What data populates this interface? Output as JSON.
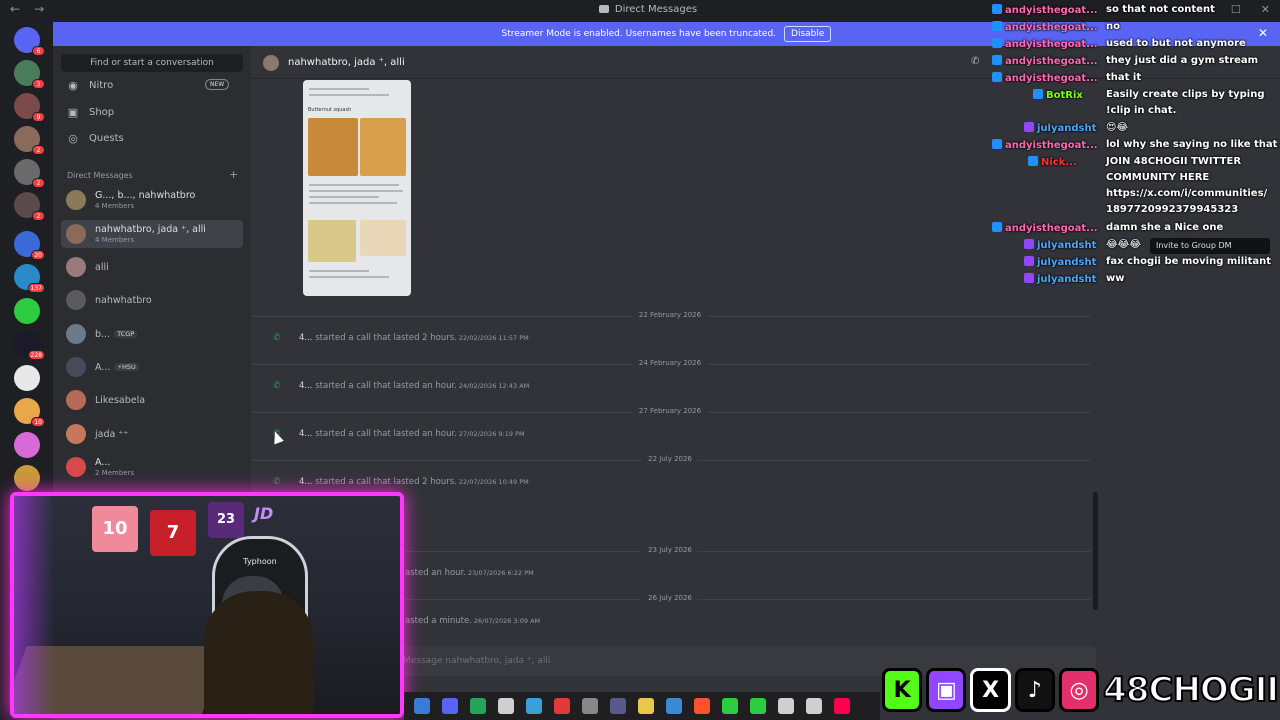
{
  "window": {
    "title": "Direct Messages",
    "back_glyph": "←",
    "forward_glyph": "→",
    "minimize_glyph": "—",
    "maximize_glyph": "☐",
    "close_glyph": "✕"
  },
  "banner": {
    "text": "Streamer Mode is enabled. Usernames have been truncated.",
    "disable_label": "Disable",
    "close_glyph": "✕"
  },
  "rail": {
    "servers": [
      {
        "color": "#5865f2",
        "badge": "6"
      },
      {
        "color": "#4a7c59",
        "badge": "3"
      },
      {
        "color": "#7a4a4a",
        "badge": "9"
      },
      {
        "color": "#8a6a5a",
        "badge": "2"
      },
      {
        "color": "#6a6a6a",
        "badge": "2"
      },
      {
        "color": "#5a4a4a",
        "badge": "2"
      },
      {
        "color": "#3a6ad8",
        "badge": "20"
      },
      {
        "color": "#2a8ac8",
        "badge": "137"
      },
      {
        "color": "#2ecc40",
        "badge": ""
      },
      {
        "color": "#1a1a2a",
        "badge": "228"
      },
      {
        "color": "#e8e8e8",
        "badge": ""
      },
      {
        "color": "#e8a84a",
        "badge": "10"
      },
      {
        "color": "#d86ad8",
        "badge": ""
      },
      {
        "color": "#c89a3a",
        "badge": ""
      }
    ]
  },
  "sidebar": {
    "search_placeholder": "Find or start a conversation",
    "nav": [
      {
        "label": "Nitro",
        "icon": "nitro-icon",
        "glyph": "◉"
      },
      {
        "label": "Shop",
        "icon": "shop-icon",
        "glyph": "▣"
      },
      {
        "label": "Quests",
        "icon": "quests-icon",
        "glyph": "◎"
      }
    ],
    "new_tag": "NEW",
    "dm_header": "Direct Messages",
    "add_glyph": "+",
    "dms": [
      {
        "name": "G..., b..., nahwhatbro",
        "sub": "4 Members",
        "color": "#8a7a5a",
        "active": false
      },
      {
        "name": "nahwhatbro, jada ⁺, alli",
        "sub": "4 Members",
        "color": "#8a6a5a",
        "active": true
      },
      {
        "name": "alli",
        "sub": "",
        "color": "#9a7a7a",
        "active": false
      },
      {
        "name": "nahwhatbro",
        "sub": "",
        "color": "#5a5a5a",
        "active": false
      },
      {
        "name": "b...",
        "sub": "",
        "tag": "TCGP",
        "color": "#6a7a8a",
        "active": false
      },
      {
        "name": "A...",
        "sub": "",
        "tag": "⚡HSU",
        "color": "#4a4a5a",
        "active": false
      },
      {
        "name": "Likesabela",
        "sub": "",
        "color": "#b86a5a",
        "active": false
      },
      {
        "name": "jada ⁺⁺",
        "sub": "",
        "color": "#c8785a",
        "active": false
      },
      {
        "name": "A...",
        "sub": "2 Members",
        "color": "#d84a4a",
        "active": false
      }
    ]
  },
  "chat": {
    "header_name": "nahwhatbro, jada ⁺, alli",
    "recipe_title": "Butternut squash",
    "composer_placeholder": "Message nahwhatbro, jada ⁺, alli",
    "date_separators": [
      "22 February 2026",
      "24 February 2026",
      "27 February 2026",
      "22 July 2026",
      "23 July 2026",
      "26 July 2026"
    ],
    "calls": [
      {
        "who": "4...",
        "text": "started a call that lasted 2 hours.",
        "ts": "22/02/2026 11:57 PM"
      },
      {
        "who": "4...",
        "text": "started a call that lasted an hour.",
        "ts": "24/02/2026 12:43 AM"
      },
      {
        "who": "4...",
        "text": "started a call that lasted an hour.",
        "ts": "27/02/2026 9:19 PM"
      },
      {
        "who": "4...",
        "text": "started a call that lasted 2 hours.",
        "ts": "22/07/2026 10:49 PM"
      },
      {
        "who": "",
        "text": "asted an hour.",
        "ts": "23/07/2026 6:22 PM"
      },
      {
        "who": "",
        "text": "asted a minute.",
        "ts": "26/07/2026 3:09 AM"
      }
    ]
  },
  "twitch_chat": [
    {
      "user": "andyisthegoat...",
      "color": "#ff69b4",
      "badge": "#1e90ff",
      "msg": "so that not content"
    },
    {
      "user": "andyisthegoat...",
      "color": "#ff69b4",
      "badge": "#1e90ff",
      "msg": "no"
    },
    {
      "user": "andyisthegoat...",
      "color": "#ff69b4",
      "badge": "#1e90ff",
      "msg": "used to but not anymore"
    },
    {
      "user": "andyisthegoat...",
      "color": "#ff69b4",
      "badge": "#1e90ff",
      "msg": "they just did a gym stream"
    },
    {
      "user": "andyisthegoat...",
      "color": "#ff69b4",
      "badge": "#1e90ff",
      "msg": "that it"
    },
    {
      "user": "BotRix",
      "color": "#7fff00",
      "badge": "#1e90ff",
      "msg": "Easily create clips by typing"
    },
    {
      "user": "julyandsht",
      "color": "#4aa8ff",
      "badge": "#9146ff",
      "msg": "😍😂"
    },
    {
      "user": "andyisthegoat...",
      "color": "#ff69b4",
      "badge": "#1e90ff",
      "msg": "lol why she saying no like that"
    },
    {
      "user": "Nick...",
      "color": "#ff3030",
      "badge": "#1e90ff",
      "msg": "JOIN 48CHOGII TWITTER"
    },
    {
      "user": "andyisthegoat...",
      "color": "#ff69b4",
      "badge": "#1e90ff",
      "msg": "damn she a Nice one"
    },
    {
      "user": "julyandsht",
      "color": "#4aa8ff",
      "badge": "#9146ff",
      "msg": "😂😂😂"
    },
    {
      "user": "julyandsht",
      "color": "#4aa8ff",
      "badge": "#9146ff",
      "msg": "fax chogii be moving militant"
    },
    {
      "user": "julyandsht",
      "color": "#4aa8ff",
      "badge": "#9146ff",
      "msg": "ww"
    }
  ],
  "twitch_continuations": [
    "!clip in chat.",
    "COMMUNITY HERE",
    "https://x.com/i/communities/",
    "1897720992379945323"
  ],
  "tooltip": "Invite to Group DM",
  "webcam": {
    "jersey_a": "10",
    "jersey_b": "7",
    "jersey_c": "23",
    "chair_brand": "Typhoon",
    "overlay_text": "JD"
  },
  "socials": {
    "kick_glyph": "K",
    "twitch_glyph": "▣",
    "x_glyph": "X",
    "tiktok_glyph": "♪",
    "instagram_glyph": "◎",
    "handle": "48CHOGII"
  },
  "taskbar_colors": [
    "#3a7bd5",
    "#5865f2",
    "#23a559",
    "#cfcfcf",
    "#3aa0d8",
    "#e03a3a",
    "#888888",
    "#5a5a8a",
    "#e8c84a",
    "#3a8ad8",
    "#fb542b",
    "#2ecc40",
    "#2ecc40",
    "#cfcfcf",
    "#cfcfcf",
    "#ff0050"
  ]
}
